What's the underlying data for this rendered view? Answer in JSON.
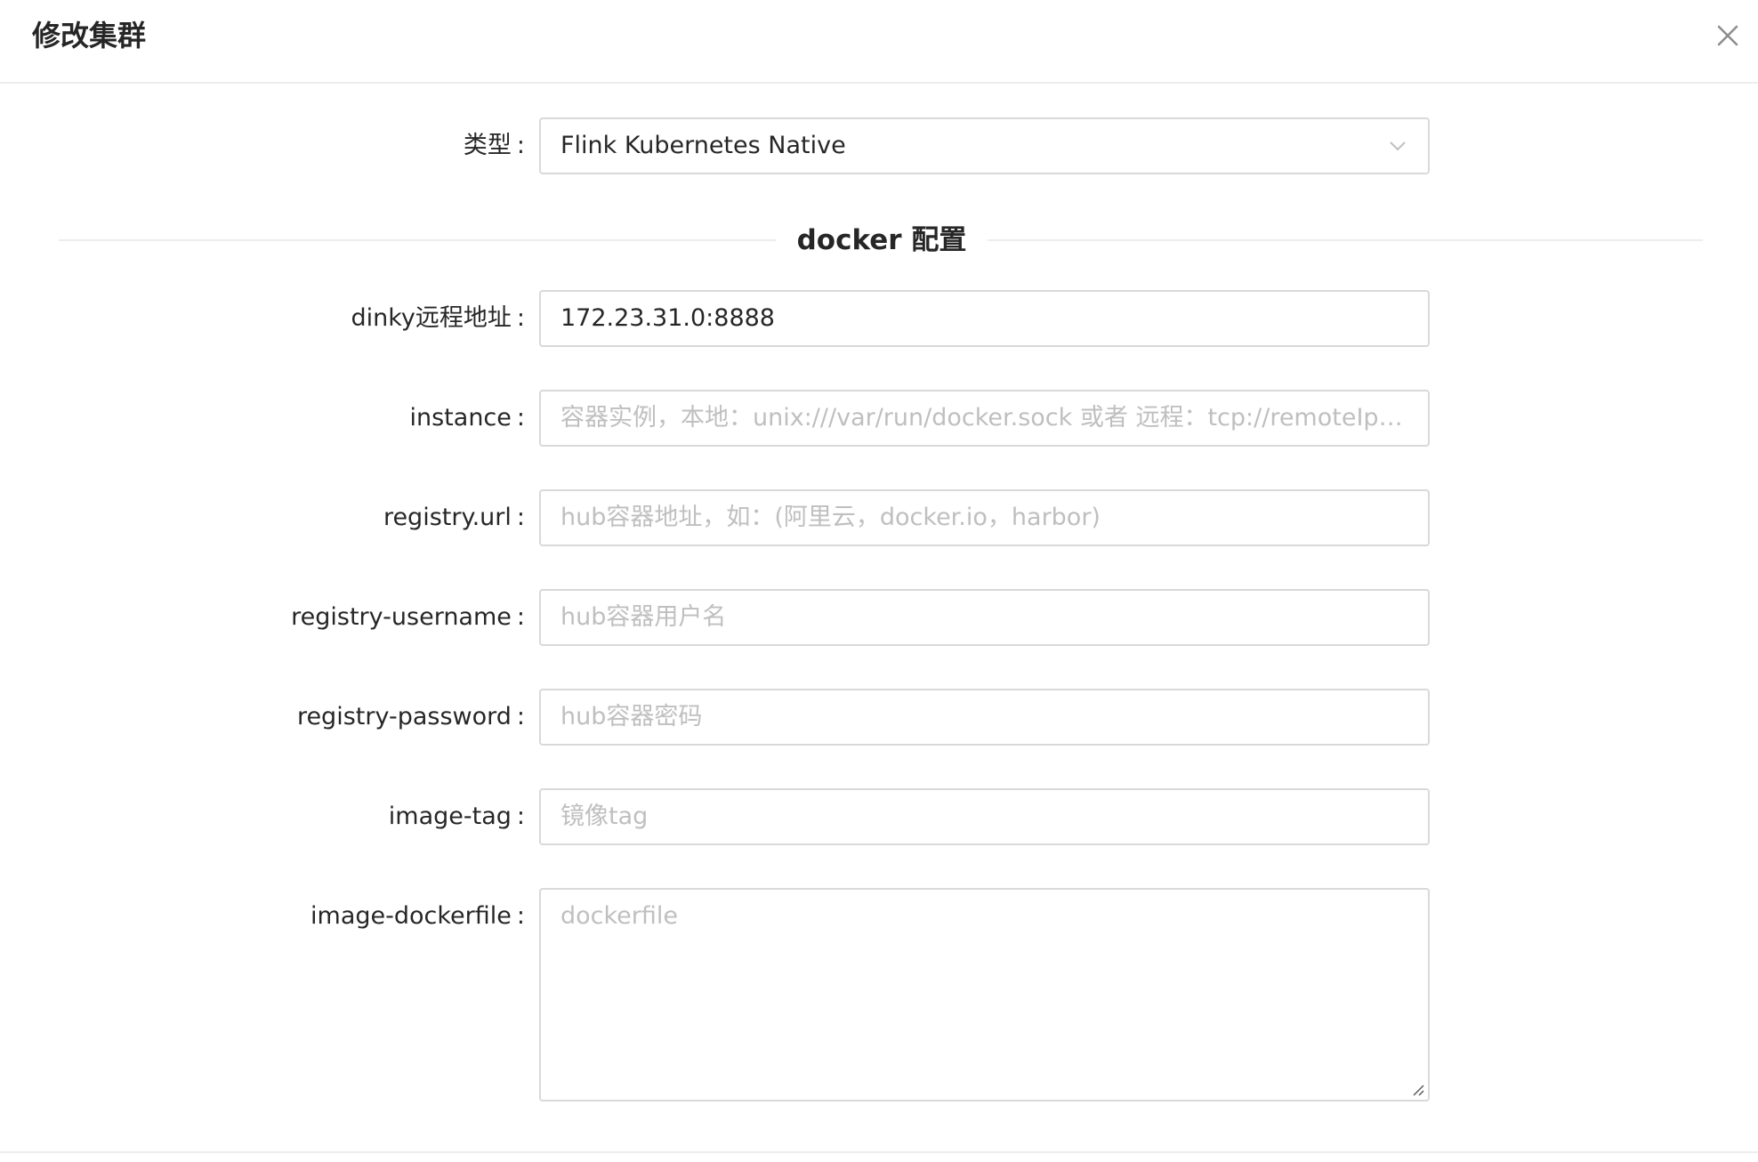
{
  "modal": {
    "title": "修改集群"
  },
  "type_field": {
    "label": "类型",
    "selected": "Flink Kubernetes Native"
  },
  "section": {
    "divider_title": "docker 配置"
  },
  "fields": {
    "dinky_address": {
      "label": "dinky远程地址",
      "value": "172.23.31.0:8888"
    },
    "instance": {
      "label": "instance",
      "placeholder": "容器实例，本地：unix:///var/run/docker.sock  或者 远程：tcp://remoteIp:..."
    },
    "registry_url": {
      "label": "registry.url",
      "placeholder": "hub容器地址，如：(阿里云，docker.io，harbor)"
    },
    "registry_username": {
      "label": "registry-username",
      "placeholder": "hub容器用户名"
    },
    "registry_password": {
      "label": "registry-password",
      "placeholder": "hub容器密码"
    },
    "image_tag": {
      "label": "image-tag",
      "placeholder": "镜像tag"
    },
    "image_dockerfile": {
      "label": "image-dockerfile",
      "placeholder": "dockerfile"
    }
  },
  "icons": {
    "close": "close-icon",
    "select_arrow": "chevron-down-icon",
    "resize": "resize-handle-icon"
  }
}
